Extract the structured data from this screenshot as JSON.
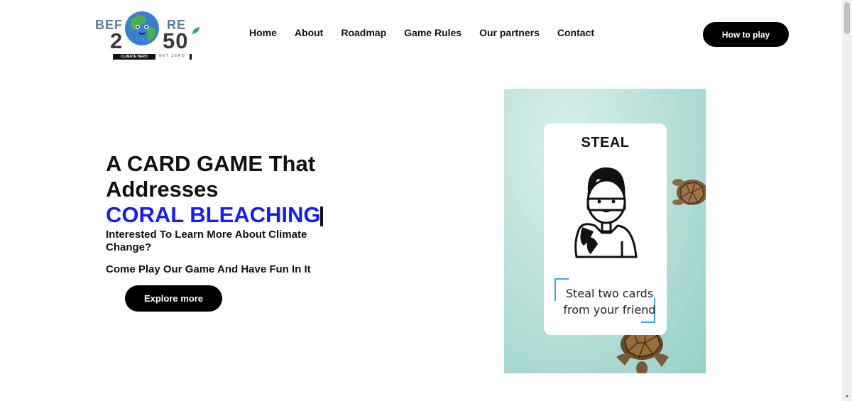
{
  "logo": {
    "text_left": "BEF",
    "text_right": "RE",
    "year_left": "2",
    "year_right": "50",
    "badge": "CLIMATE HERO",
    "tagline": "NET ZERO"
  },
  "nav": {
    "items": [
      "Home",
      "About",
      "Roadmap",
      "Game Rules",
      "Our partners",
      "Contact"
    ],
    "cta_label": "How to play"
  },
  "hero": {
    "title": "A CARD GAME That Addresses",
    "highlight": "CORAL BLEACHING",
    "subtitle": "Interested To Learn More About Climate Change?",
    "subtitle2": "Come Play Our Game And Have Fun In It",
    "button_label": "Explore more"
  },
  "card": {
    "title": "STEAL",
    "line1": "Steal two cards",
    "line2": "from your friend"
  },
  "colors": {
    "highlight": "#1a1aff",
    "button_bg": "#000000",
    "card_bg": "#a8d8d0",
    "bracket": "#3aa8d8"
  },
  "icons": [
    "globe-icon",
    "leaf-icon",
    "turtle-icon",
    "character-illustration"
  ]
}
